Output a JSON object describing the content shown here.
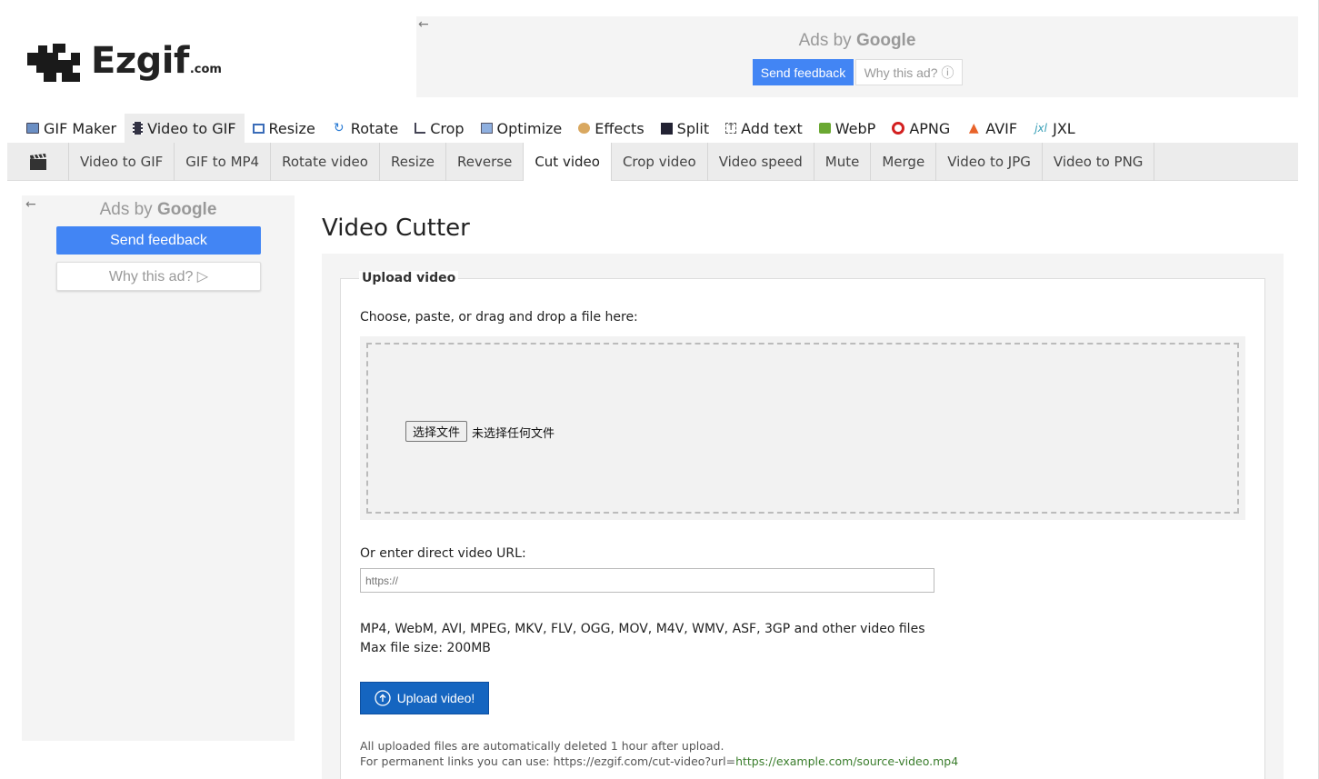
{
  "logo": {
    "name": "Ezgif",
    "suffix": ".com"
  },
  "top_ad": {
    "back": "←",
    "ads_by": "Ads by",
    "google": "Google",
    "feedback": "Send feedback",
    "why": "Why this ad? ⓘ"
  },
  "main_nav": [
    {
      "label": "GIF Maker",
      "icon": "gif-maker-icon"
    },
    {
      "label": "Video to GIF",
      "icon": "film-icon",
      "active": true
    },
    {
      "label": "Resize",
      "icon": "resize-icon"
    },
    {
      "label": "Rotate",
      "icon": "rotate-icon"
    },
    {
      "label": "Crop",
      "icon": "crop-icon"
    },
    {
      "label": "Optimize",
      "icon": "optimize-icon"
    },
    {
      "label": "Effects",
      "icon": "palette-icon"
    },
    {
      "label": "Split",
      "icon": "split-icon"
    },
    {
      "label": "Add text",
      "icon": "add-text-icon"
    },
    {
      "label": "WebP",
      "icon": "webp-icon"
    },
    {
      "label": "APNG",
      "icon": "apng-icon"
    },
    {
      "label": "AVIF",
      "icon": "avif-icon"
    },
    {
      "label": "JXL",
      "icon": "jxl-icon"
    }
  ],
  "sub_nav": [
    "Video to GIF",
    "GIF to MP4",
    "Rotate video",
    "Resize",
    "Reverse",
    "Cut video",
    "Crop video",
    "Video speed",
    "Mute",
    "Merge",
    "Video to JPG",
    "Video to PNG"
  ],
  "sub_nav_active": "Cut video",
  "side_ad": {
    "back": "←",
    "ads_by": "Ads by",
    "google": "Google",
    "feedback": "Send feedback",
    "why": "Why this ad? ▷"
  },
  "page": {
    "title": "Video Cutter",
    "legend": "Upload video",
    "choose_label": "Choose, paste, or drag and drop a file here:",
    "file_button": "选择文件",
    "file_none": "未选择任何文件",
    "url_label": "Or enter direct video URL:",
    "url_placeholder": "https://",
    "formats": "MP4, WebM, AVI, MPEG, MKV, FLV, OGG, MOV, M4V, WMV, ASF, 3GP and other video files",
    "max_size": "Max file size: 200MB",
    "upload_button": "Upload video!",
    "note_line1": "All uploaded files are automatically deleted 1 hour after upload.",
    "note_line2_prefix": "For permanent links you can use: https://ezgif.com/cut-video?url=",
    "note_line2_link": "https://example.com/source-video.mp4"
  },
  "colors": {
    "accent": "#4285f4",
    "upload": "#1565c0",
    "link": "#3a7d2c"
  }
}
